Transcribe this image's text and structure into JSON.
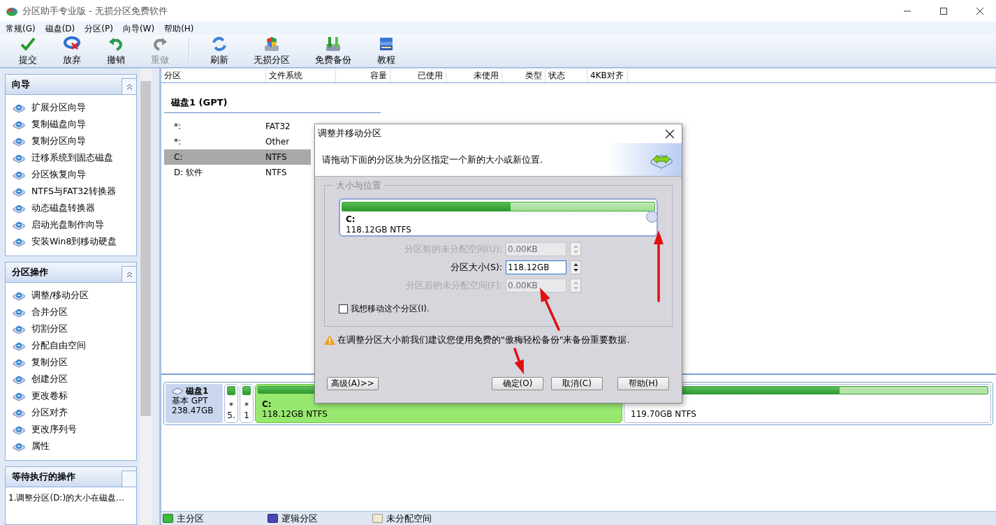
{
  "window": {
    "title": "分区助手专业版 - 无损分区免费软件"
  },
  "menu": [
    "常规(G)",
    "磁盘(D)",
    "分区(P)",
    "向导(W)",
    "帮助(H)"
  ],
  "toolbar": [
    {
      "label": "提交",
      "kind": "check",
      "disabled": false
    },
    {
      "label": "放弃",
      "kind": "discard",
      "disabled": false
    },
    {
      "label": "撤销",
      "kind": "undo",
      "disabled": false
    },
    {
      "label": "重做",
      "kind": "redo",
      "disabled": true
    },
    {
      "label": "刷新",
      "kind": "refresh",
      "disabled": false,
      "separator_before": true
    },
    {
      "label": "无损分区",
      "kind": "shield",
      "disabled": false
    },
    {
      "label": "免费备份",
      "kind": "backup",
      "disabled": false
    },
    {
      "label": "教程",
      "kind": "book",
      "disabled": false
    }
  ],
  "sidebar": [
    {
      "title": "向导",
      "collapsible": true,
      "items": [
        "扩展分区向导",
        "复制磁盘向导",
        "复制分区向导",
        "迁移系统到固态磁盘",
        "分区恢复向导",
        "NTFS与FAT32转换器",
        "动态磁盘转换器",
        "启动光盘制作向导",
        "安装Win8到移动硬盘"
      ]
    },
    {
      "title": "分区操作",
      "collapsible": true,
      "items": [
        "调整/移动分区",
        "合并分区",
        "切割分区",
        "分配自由空间",
        "复制分区",
        "创建分区",
        "更改卷标",
        "分区对齐",
        "更改序列号",
        "属性"
      ]
    },
    {
      "title": "等待执行的操作",
      "collapsible": false,
      "items": [
        "1.调整分区(D:)的大小在磁盘…"
      ]
    }
  ],
  "table": {
    "columns": [
      "分区",
      "文件系统",
      "容量",
      "已使用",
      "未使用",
      "类型",
      "状态",
      "4KB对齐"
    ],
    "disk_header": "磁盘1 (GPT)",
    "rows": [
      {
        "partition": "*:",
        "file_system": "FAT32",
        "selected": false
      },
      {
        "partition": "*:",
        "file_system": "Other",
        "selected": false
      },
      {
        "partition": "C:",
        "file_system": "NTFS",
        "selected": true
      },
      {
        "partition": "D: 软件",
        "file_system": "NTFS",
        "selected": false
      }
    ]
  },
  "disk_map": {
    "disk": {
      "name": "磁盘1",
      "type": "基本 GPT",
      "size": "238.47GB"
    },
    "partitions": [
      {
        "kind": "narrow",
        "label": "*",
        "size": "5.",
        "selected": false
      },
      {
        "kind": "narrow",
        "label": "*",
        "size": "1",
        "selected": false
      },
      {
        "kind": "wide",
        "label": "C:",
        "size": "118.12GB NTFS",
        "selected": true
      },
      {
        "kind": "wide",
        "size": "119.70GB NTFS",
        "level": 0.59,
        "selected": false
      }
    ]
  },
  "legend": [
    {
      "label": "主分区",
      "color": "#3fb83f"
    },
    {
      "label": "逻辑分区",
      "color": "#4646b4"
    },
    {
      "label": "未分配空间",
      "color": "#f3e8d2"
    }
  ],
  "dialog": {
    "title": "调整并移动分区",
    "instruction": "请拖动下面的分区块为分区指定一个新的大小或新位置.",
    "group_label": "大小与位置",
    "partition": {
      "label": "C:",
      "size": "118.12GB NTFS",
      "level": 0.54
    },
    "fields": [
      {
        "label": "分区前的未分配空间(U):",
        "value": "0.00KB",
        "disabled": true
      },
      {
        "label": "分区大小(S):",
        "value": "118.12GB",
        "disabled": false
      },
      {
        "label": "分区后的未分配空间(F):",
        "value": "0.00KB",
        "disabled": true
      }
    ],
    "move_checkbox": {
      "label": "我想移动这个分区(I).",
      "checked": false
    },
    "warning": "在调整分区大小前我们建议您使用免费的\"傲梅轻松备份\"来备份重要数据.",
    "buttons": [
      {
        "label": "高级(A)>>",
        "kind": "advanced"
      },
      {
        "label": "确定(O)",
        "kind": "ok"
      },
      {
        "label": "取消(C)",
        "kind": "cancel"
      },
      {
        "label": "帮助(H)",
        "kind": "help"
      }
    ]
  }
}
